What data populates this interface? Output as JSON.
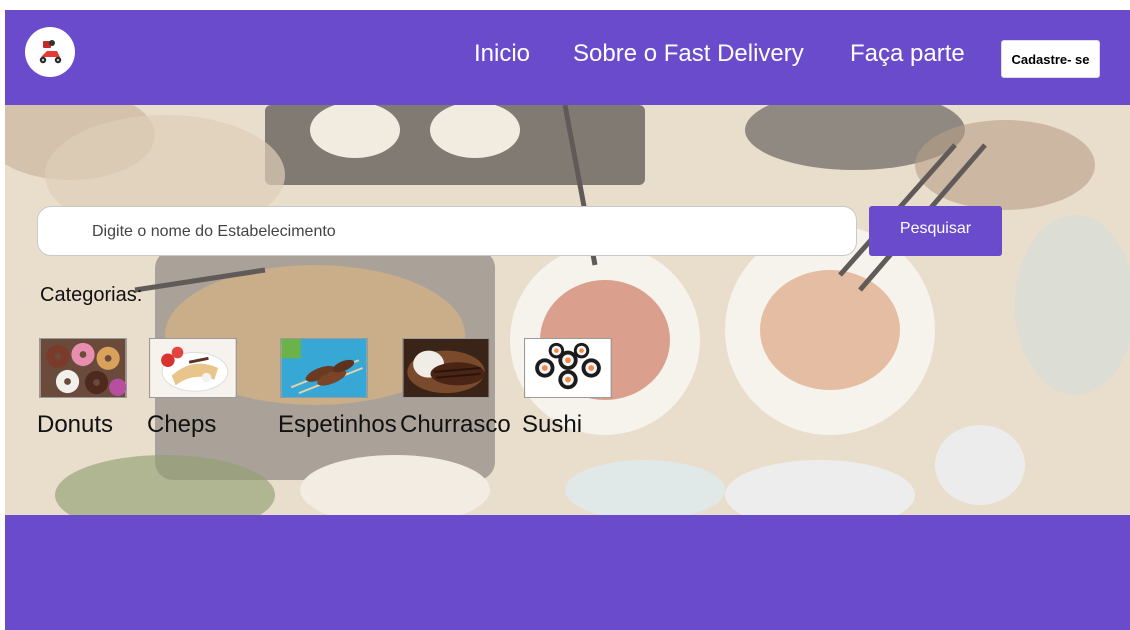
{
  "header": {
    "logo_icon": "delivery-scooter-icon",
    "nav": [
      {
        "label": "Inicio"
      },
      {
        "label": "Sobre o Fast Delivery"
      },
      {
        "label": "Faça parte"
      }
    ],
    "signup_label": "Cadastre- se"
  },
  "search": {
    "placeholder": "Digite o nome do Estabelecimento",
    "value": "",
    "button_label": "Pesquisar"
  },
  "categories": {
    "heading": "Categorias:",
    "items": [
      {
        "label": "Donuts"
      },
      {
        "label": "Cheps"
      },
      {
        "label": "Espetinhos"
      },
      {
        "label": "Churrasco"
      },
      {
        "label": "Sushi"
      }
    ]
  },
  "colors": {
    "brand": "#6a4bcc",
    "button_text": "#ffffff"
  }
}
